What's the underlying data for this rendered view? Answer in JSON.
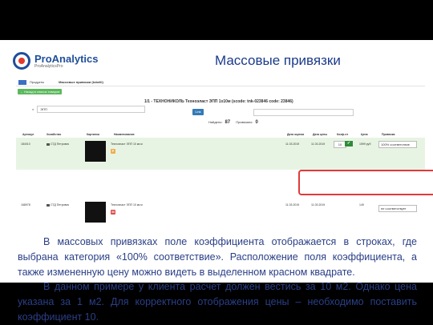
{
  "slide": {
    "logo_name": "ProAnalytics",
    "logo_tagline": "ProAnalyticsPro",
    "title": "Массовые привязки",
    "paragraph1": "В массовых привязках поле коэффициента отображается в строках, где выбрана категория «100% соответствие». Расположение поля коэффициента, а также измененную цену можно видеть в выделенном красном квадрате.",
    "paragraph2": "В данном примере у клиента расчет должен вестись за 10 м2. Однако цена указана за 1 м2. Для корректного отображения цены – необходимо поставить коэффициент 10."
  },
  "app": {
    "crumb": "Продукты",
    "section": "Массовые привязки (tobelli)",
    "back_button": "← Назад в список товаров",
    "product_title": "1/1 - ТЕХНОНИКОЛЬ Техноэласт ЭПП 1х10м (scode: tnk-023846 code: 23846)",
    "search_value": "ЭПП",
    "search_button": "Link",
    "found_label": "Найдено:",
    "found_count": "87",
    "linked_label": "Привязано:",
    "linked_count": "0",
    "columns": [
      "Артикул",
      "Хозяйство",
      "Картинка",
      "Наименование",
      "Дата оценки",
      "Дата цены",
      "Коэф-нт",
      "Цена",
      "Привязка"
    ],
    "rows": [
      {
        "sku": "184010",
        "shop": "СТД Петрович",
        "name": "Техноэласт ЭПП 10 кв.м",
        "date1": "11.03.2019",
        "date2": "11.03.2019",
        "coef": "10",
        "price": "1599 руб",
        "binding": "100% соответствие",
        "tag": "P"
      },
      {
        "sku": "168978",
        "shop": "СТД Петрович",
        "name": "Техноэласт ЭПП 10 кв.м",
        "date1": "11.03.2019",
        "date2": "11.03.2019",
        "coef": "",
        "price": "149",
        "binding": "не соответствует",
        "tag": "M"
      }
    ]
  }
}
